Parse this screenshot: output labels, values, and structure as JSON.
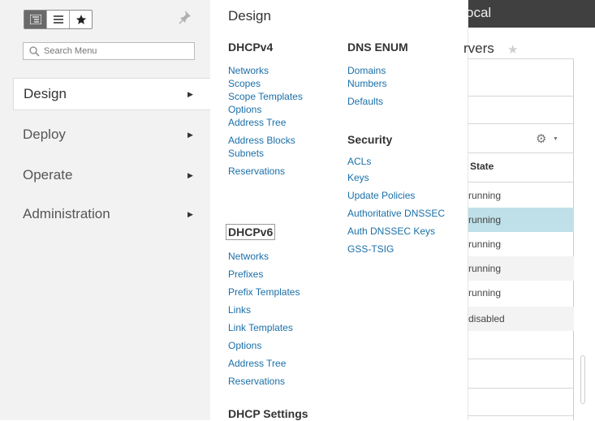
{
  "toolbar": {
    "views": [
      "tree-view-icon",
      "list-view-icon",
      "star-icon"
    ],
    "active_view": "tree-view-icon",
    "pin": "pin-icon"
  },
  "search": {
    "placeholder": "Search Menu"
  },
  "nav": {
    "items": [
      {
        "label": "Design",
        "active": true
      },
      {
        "label": "Deploy",
        "active": false
      },
      {
        "label": "Operate",
        "active": false
      },
      {
        "label": "Administration",
        "active": false
      }
    ]
  },
  "menu": {
    "title": "Design",
    "dhcpv4": {
      "heading": "DHCPv4",
      "links": [
        "Networks",
        "Scopes",
        "Scope Templates",
        "Options",
        "Address Tree",
        "Address Blocks",
        "Subnets",
        "Reservations"
      ]
    },
    "dhcpv6": {
      "heading": "DHCPv6",
      "links": [
        "Networks",
        "Prefixes",
        "Prefix Templates",
        "Links",
        "Link Templates",
        "Options",
        "Address Tree",
        "Reservations"
      ]
    },
    "dhcp_settings": {
      "heading": "DHCP Settings"
    },
    "dns_enum": {
      "heading": "DNS ENUM",
      "links": [
        "Domains",
        "Numbers",
        "Defaults"
      ]
    },
    "security": {
      "heading": "Security",
      "links": [
        "ACLs",
        "Keys",
        "Update Policies",
        "Authoritative DNSSEC",
        "Auth DNSSEC Keys",
        "GSS-TSIG"
      ]
    }
  },
  "background": {
    "header_text": "ocal",
    "page_title": "rvers",
    "column_header": "State",
    "rows": [
      "running",
      "running",
      "running",
      "running",
      "running",
      "disabled"
    ],
    "selected_row": 1
  }
}
